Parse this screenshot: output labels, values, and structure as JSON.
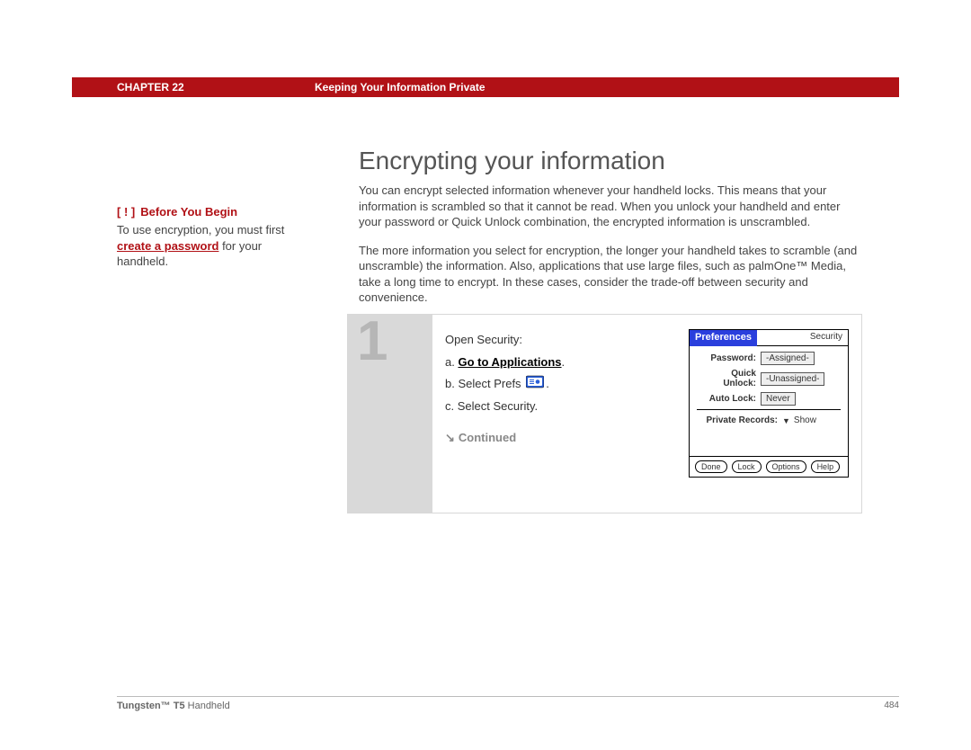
{
  "header": {
    "chapter_label": "CHAPTER 22",
    "chapter_title": "Keeping Your Information Private"
  },
  "sidebar": {
    "before_begin_marker": "[ ! ]",
    "before_begin_label": "Before You Begin",
    "text_part1": "To use encryption, you must first ",
    "link_text": "create a password",
    "text_part2": " for your handheld."
  },
  "main": {
    "heading": "Encrypting your information",
    "para1": "You can encrypt selected information whenever your handheld locks. This means that your information is scrambled so that it cannot be read. When you unlock your handheld and enter your password or Quick Unlock combination, the encrypted information is unscrambled.",
    "para2": "The more information you select for encryption, the longer your handheld takes to scramble (and unscramble) the information. Also, applications that use large files, such as palmOne™ Media, take a long time to encrypt. In these cases, consider the trade-off between security and convenience."
  },
  "step": {
    "number": "1",
    "open_line": "Open Security:",
    "a_prefix": "a.",
    "a_link": "Go to Applications",
    "a_suffix": ".",
    "b_prefix": "b.",
    "b_text_before": "Select Prefs",
    "b_text_after": ".",
    "c_prefix": "c.",
    "c_text": "Select Security.",
    "continued": "Continued"
  },
  "palm": {
    "title_left": "Preferences",
    "title_right": "Security",
    "rows": {
      "password_label": "Password:",
      "password_value": "-Assigned-",
      "quick_label": "Quick Unlock:",
      "quick_value": "-Unassigned-",
      "auto_label": "Auto Lock:",
      "auto_value": "Never",
      "private_label": "Private Records:",
      "private_value": "Show"
    },
    "buttons": {
      "done": "Done",
      "lock": "Lock",
      "options": "Options",
      "help": "Help"
    }
  },
  "footer": {
    "product_bold": "Tungsten™ T5",
    "product_rest": " Handheld",
    "page": "484"
  }
}
